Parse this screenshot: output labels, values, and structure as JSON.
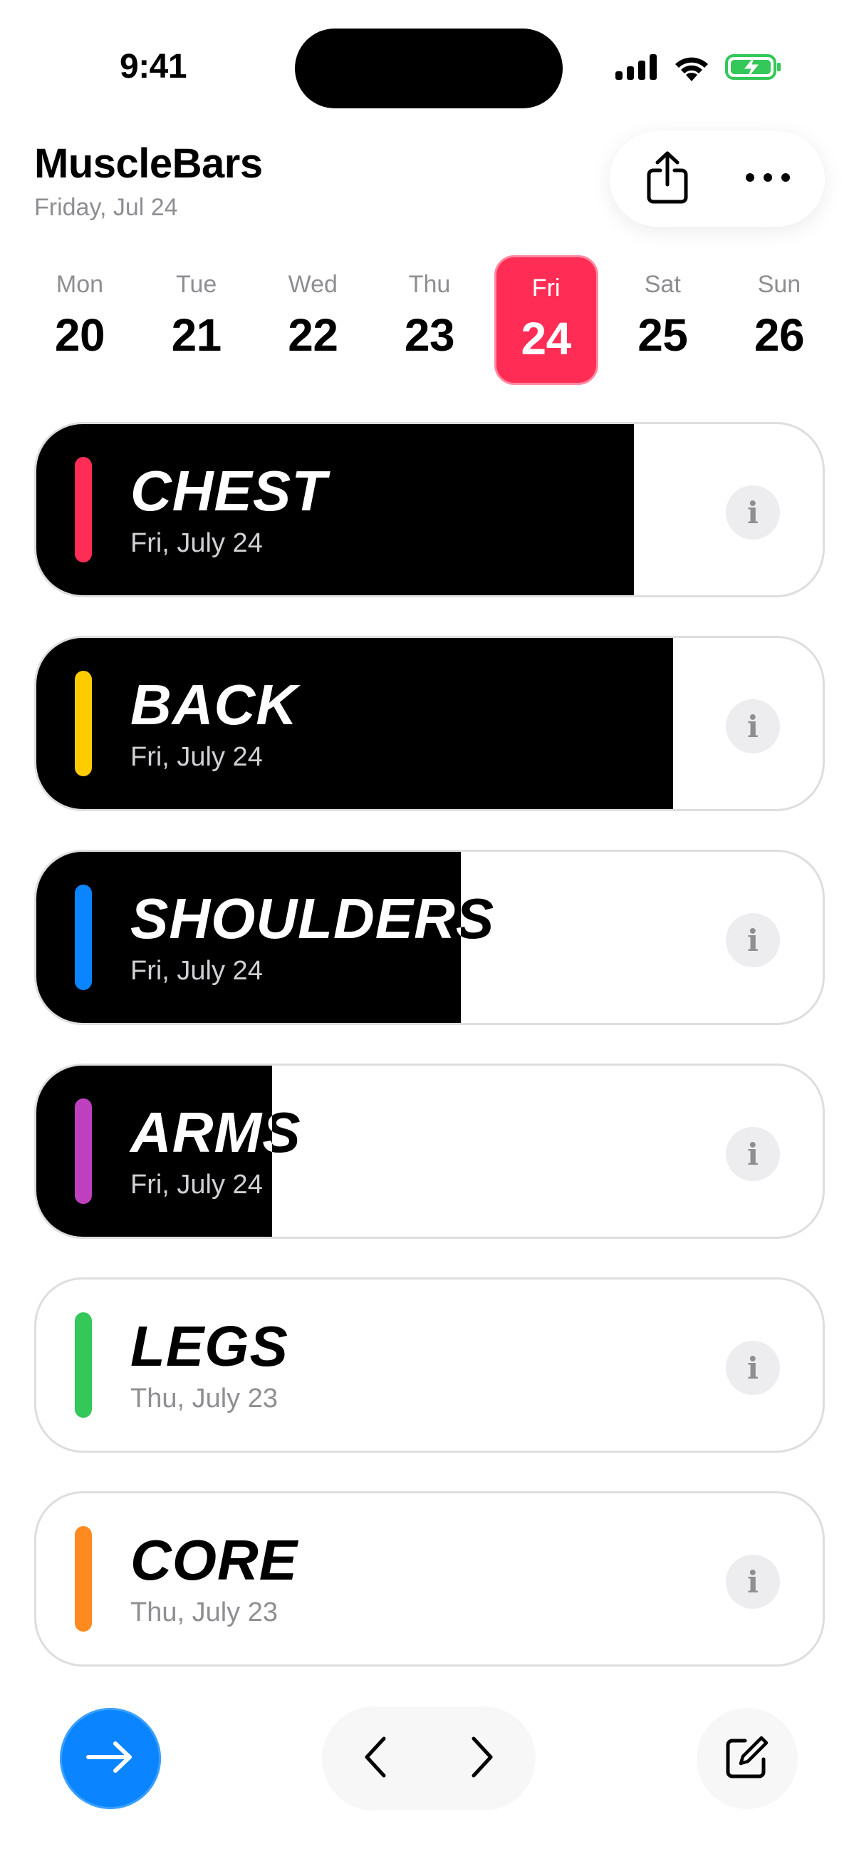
{
  "status_bar": {
    "time": "9:41",
    "icons": [
      "cellular-signal-icon",
      "wifi-icon",
      "battery-charging-icon"
    ],
    "battery_color": "#34c759"
  },
  "header": {
    "title": "MuscleBars",
    "subtitle": "Friday, Jul 24",
    "actions": [
      "share-icon",
      "more-icon"
    ]
  },
  "week": {
    "selected_index": 4,
    "selected_color": "#ff2d55",
    "days": [
      {
        "name": "Mon",
        "num": "20"
      },
      {
        "name": "Tue",
        "num": "21"
      },
      {
        "name": "Wed",
        "num": "22"
      },
      {
        "name": "Thu",
        "num": "23"
      },
      {
        "name": "Fri",
        "num": "24"
      },
      {
        "name": "Sat",
        "num": "25"
      },
      {
        "name": "Sun",
        "num": "26"
      }
    ]
  },
  "muscles": [
    {
      "name": "CHEST",
      "date": "Fri, July 24",
      "color": "#ff2d55",
      "progress": 0.76
    },
    {
      "name": "BACK",
      "date": "Fri, July 24",
      "color": "#ffcc00",
      "progress": 0.81
    },
    {
      "name": "SHOULDERS",
      "date": "Fri, July 24",
      "color": "#0a84ff",
      "progress": 0.54
    },
    {
      "name": "ARMS",
      "date": "Fri, July 24",
      "color": "#bf40bf",
      "progress": 0.3
    },
    {
      "name": "LEGS",
      "date": "Thu, July 23",
      "color": "#34c759",
      "progress": 0
    },
    {
      "name": "CORE",
      "date": "Thu, July 23",
      "color": "#ff8a1f",
      "progress": 0
    }
  ],
  "info_glyph": "i",
  "bottom_bar": {
    "primary_icon": "arrow-right-icon",
    "primary_color": "#0a84ff",
    "nav_icons": [
      "chevron-left-icon",
      "chevron-right-icon"
    ],
    "compose_icon": "compose-icon"
  }
}
